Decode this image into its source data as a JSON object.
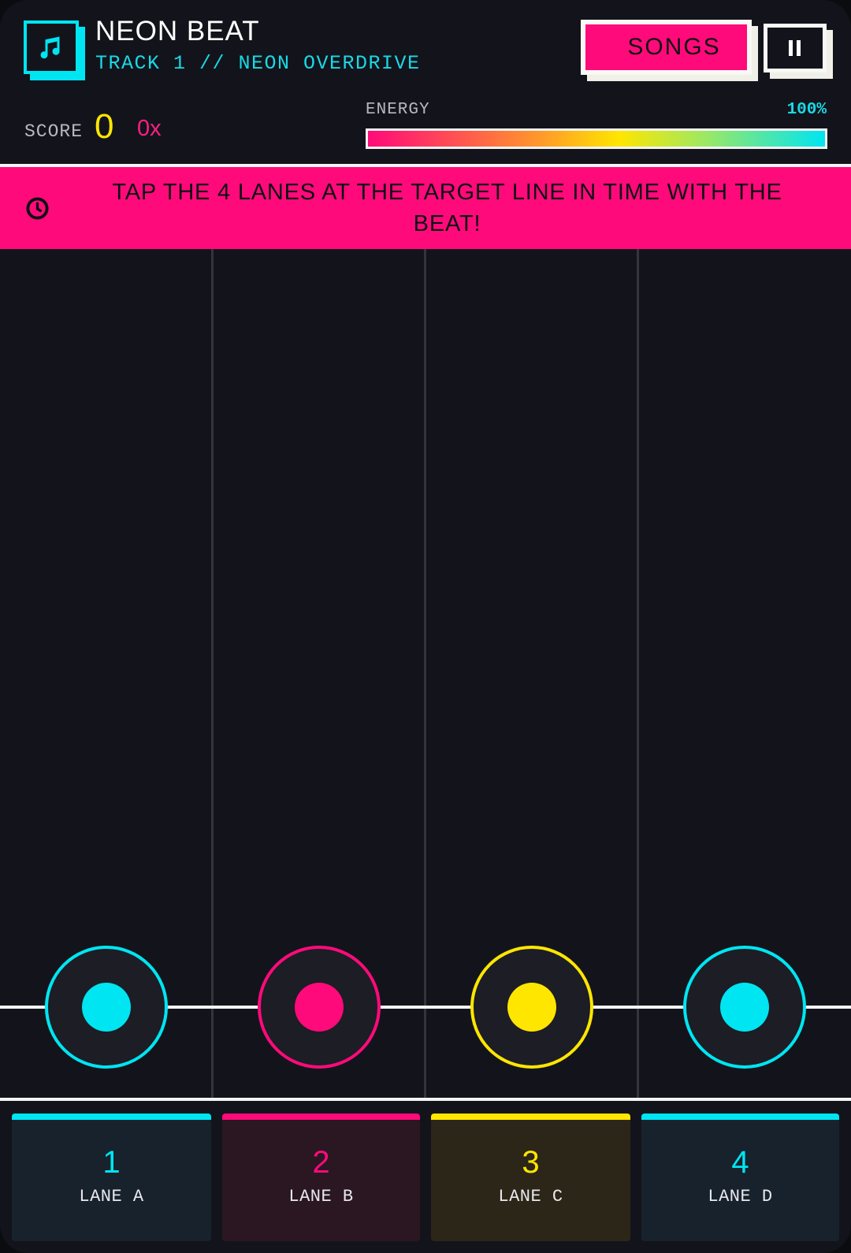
{
  "header": {
    "logo_icon": "music-note-icon",
    "title": "NEON BEAT",
    "subtitle": "TRACK 1 // NEON OVERDRIVE",
    "songs_label": "SONGS",
    "pause_icon": "pause-icon"
  },
  "stats": {
    "score_label": "SCORE",
    "score_value": "0",
    "combo": "0x",
    "energy_label": "ENERGY",
    "energy_text": "100%",
    "energy_fraction": 1.0
  },
  "banner": {
    "icon": "clock-icon",
    "text": "TAP THE 4 LANES AT THE TARGET LINE IN TIME WITH THE BEAT!"
  },
  "lanes": [
    {
      "number": "1",
      "label": "LANE A",
      "color": "#00e5f2",
      "button_bg": "#17222c"
    },
    {
      "number": "2",
      "label": "LANE B",
      "color": "#ff0a7a",
      "button_bg": "#2a1722"
    },
    {
      "number": "3",
      "label": "LANE C",
      "color": "#ffe600",
      "button_bg": "#2c2618"
    },
    {
      "number": "4",
      "label": "LANE D",
      "color": "#00e5f2",
      "button_bg": "#17222c"
    }
  ],
  "colors": {
    "background": "#13141b",
    "accent_pink": "#ff0a7a",
    "accent_cyan": "#00e5f2",
    "accent_yellow": "#ffe600"
  }
}
